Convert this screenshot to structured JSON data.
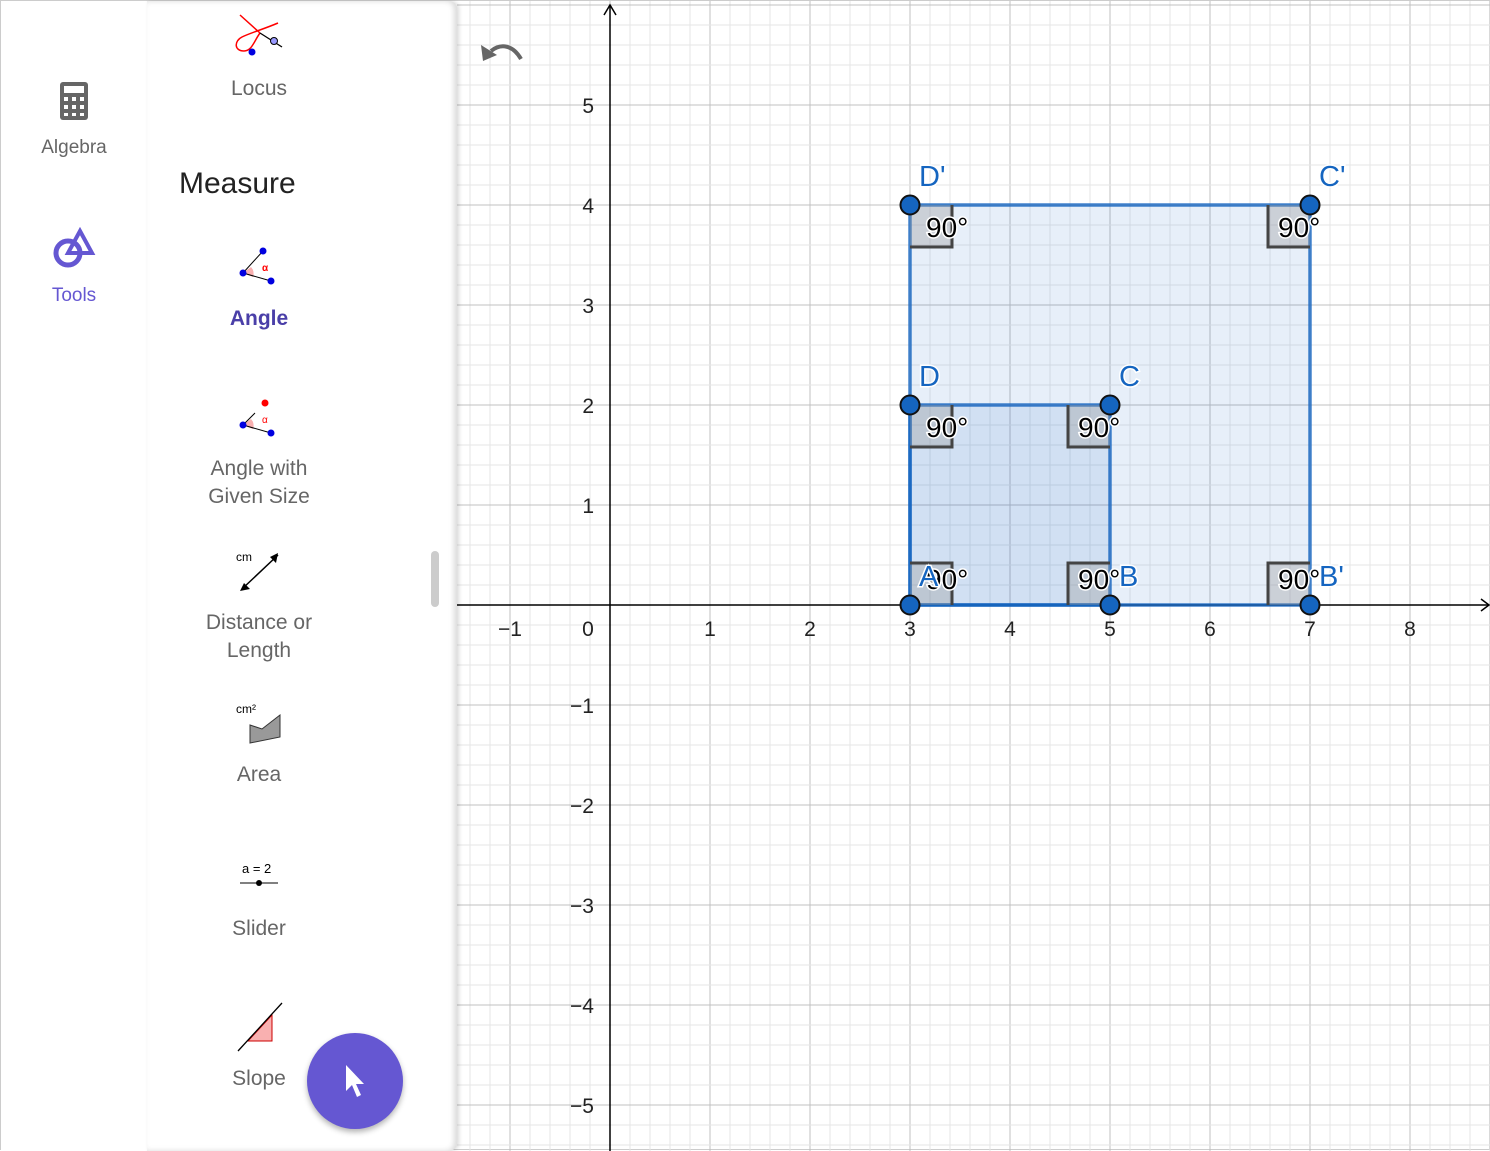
{
  "nav": {
    "items": [
      {
        "label": "Algebra",
        "icon": "calculator-icon",
        "active": false
      },
      {
        "label": "Tools",
        "icon": "tools-shapes-icon",
        "active": true
      }
    ]
  },
  "panel": {
    "section": "Measure",
    "tools": [
      {
        "label": "Locus",
        "icon": "locus-icon"
      },
      {
        "label": "Angle",
        "icon": "angle-icon",
        "selected": true
      },
      {
        "label": "Angle with\nGiven Size",
        "icon": "angle-given-size-icon"
      },
      {
        "label": "Distance or\nLength",
        "icon": "distance-icon",
        "icon_text": "cm"
      },
      {
        "label": "Area",
        "icon": "area-icon",
        "icon_text": "cm²"
      },
      {
        "label": "Slider",
        "icon": "slider-icon",
        "icon_text": "a = 2"
      },
      {
        "label": "Slope",
        "icon": "slope-icon"
      }
    ]
  },
  "fab": {
    "icon": "pointer-arrow-icon",
    "color": "#6557d2"
  },
  "graph": {
    "undo_icon": "undo-icon",
    "x_ticks": [
      "−1",
      "0",
      "1",
      "2",
      "3",
      "4",
      "5",
      "6",
      "7",
      "8"
    ],
    "y_ticks": [
      "5",
      "4",
      "3",
      "2",
      "1",
      "−1",
      "−2",
      "−3",
      "−4",
      "−5"
    ],
    "xlim": [
      -1.5,
      8.8
    ],
    "ylim": [
      -5.4,
      6
    ],
    "point_color": "#1565c0",
    "polygons": [
      {
        "name": "ABCD",
        "vertices": [
          [
            3,
            0
          ],
          [
            5,
            0
          ],
          [
            5,
            2
          ],
          [
            3,
            2
          ]
        ],
        "fill": "#1565c0"
      },
      {
        "name": "AB'C'D'",
        "vertices": [
          [
            3,
            0
          ],
          [
            7,
            0
          ],
          [
            7,
            4
          ],
          [
            3,
            4
          ]
        ],
        "fill": "#1565c0"
      }
    ],
    "points": [
      {
        "label": "A",
        "x": 3,
        "y": 0
      },
      {
        "label": "B",
        "x": 5,
        "y": 0
      },
      {
        "label": "C",
        "x": 5,
        "y": 2
      },
      {
        "label": "D",
        "x": 3,
        "y": 2
      },
      {
        "label": "B'",
        "x": 7,
        "y": 0
      },
      {
        "label": "C'",
        "x": 7,
        "y": 4
      },
      {
        "label": "D'",
        "x": 3,
        "y": 4
      }
    ],
    "angles": [
      {
        "x": 3,
        "y": 0,
        "dir": [
          1,
          1
        ],
        "label": "90°"
      },
      {
        "x": 5,
        "y": 0,
        "dir": [
          -1,
          1
        ],
        "label": "90°"
      },
      {
        "x": 5,
        "y": 2,
        "dir": [
          -1,
          -1
        ],
        "label": "90°"
      },
      {
        "x": 3,
        "y": 2,
        "dir": [
          1,
          -1
        ],
        "label": "90°"
      },
      {
        "x": 7,
        "y": 0,
        "dir": [
          -1,
          1
        ],
        "label": "90°"
      },
      {
        "x": 7,
        "y": 4,
        "dir": [
          -1,
          -1
        ],
        "label": "90°"
      },
      {
        "x": 3,
        "y": 4,
        "dir": [
          1,
          -1
        ],
        "label": "90°"
      }
    ]
  }
}
